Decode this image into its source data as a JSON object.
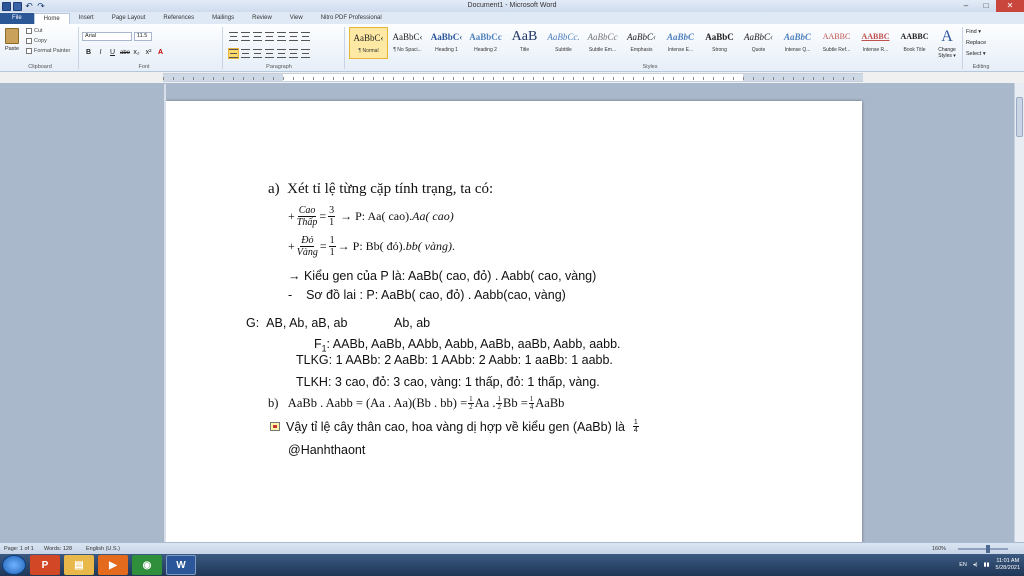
{
  "window": {
    "title": "Document1 - Microsoft Word",
    "controls": [
      "–",
      "□",
      "✕"
    ]
  },
  "tabs": [
    "File",
    "Home",
    "Insert",
    "Page Layout",
    "References",
    "Mailings",
    "Review",
    "View",
    "Nitro PDF Professional"
  ],
  "ribbon": {
    "clipboard": {
      "paste": "Paste",
      "cut": "Cut",
      "copy": "Copy",
      "format_painter": "Format Painter",
      "label": "Clipboard"
    },
    "font": {
      "name": "Arial",
      "size": "11.5",
      "label": "Font",
      "buttons": [
        "B",
        "I",
        "U",
        "abe",
        "x₂",
        "x²"
      ]
    },
    "paragraph": {
      "label": "Paragraph"
    },
    "styles": {
      "label": "Styles",
      "items": [
        {
          "sample": "AaBbC‹",
          "name": "¶ Normal"
        },
        {
          "sample": "AaBbC‹",
          "name": "¶ No Spaci..."
        },
        {
          "sample": "AaBbC‹",
          "name": "Heading 1"
        },
        {
          "sample": "AaBbCc",
          "name": "Heading 2"
        },
        {
          "sample": "AaB",
          "name": "Title"
        },
        {
          "sample": "AaBbCc.",
          "name": "Subtitle"
        },
        {
          "sample": "AaBbCc",
          "name": "Subtle Em..."
        },
        {
          "sample": "AaBbC‹",
          "name": "Emphasis"
        },
        {
          "sample": "AaBbC",
          "name": "Intense E..."
        },
        {
          "sample": "AaBbC",
          "name": "Strong"
        },
        {
          "sample": "AaBbC‹",
          "name": "Quote"
        },
        {
          "sample": "AaBbC",
          "name": "Intense Q..."
        },
        {
          "sample": "AABBC",
          "name": "Subtle Ref..."
        },
        {
          "sample": "AABBC",
          "name": "Intense R..."
        },
        {
          "sample": "AABBC",
          "name": "Book Title"
        }
      ]
    },
    "change_styles": {
      "glyph": "A",
      "label": "Change Styles ▾"
    },
    "editing": {
      "find": "Find ▾",
      "replace": "Replace",
      "select": "Select ▾",
      "label": "Editing"
    }
  },
  "document": {
    "line_a_label": "a)",
    "line_a_text": "Xét tỉ lệ từng cặp tính trạng, ta có:",
    "row1": {
      "plus": "+",
      "num": "Cao",
      "den": "Thấp",
      "eq": "=",
      "fnum": "3",
      "fden": "1",
      "arrow": "→",
      "text": "P: Aa( cao). ",
      "italic": "Aa( cao)"
    },
    "row2": {
      "plus": "+",
      "num": "Đỏ",
      "den": "Vàng",
      "eq": "=",
      "fnum": "1",
      "fden": "1",
      "arrow": "→",
      "text": "P: Bb( đỏ). ",
      "italic": "bb( vàng)",
      "end": "."
    },
    "kieu_gen": "→ Kiểu gen của P là: AaBb( cao, đỏ) . Aabb( cao, vàng)",
    "so_do_dash": "-",
    "so_do": "Sơ đồ lai : P: AaBb( cao, đỏ) . Aabb(cao, vàng)",
    "gametes_label": "G:",
    "gametes_1": "AB, Ab, aB, ab",
    "gametes_2": "Ab, ab",
    "f1_prefix": "F",
    "f1_sub": "1",
    "f1_text": ": AABb, AaBb, AAbb, Aabb, AaBb, aaBb, Aabb, aabb.",
    "tlkg": "TLKG: 1 AABb: 2 AaBb: 1 AAbb: 2 Aabb: 1 aaBb: 1 aabb.",
    "tlkh": "TLKH: 3 cao, đỏ: 3 cao, vàng: 1 thấp, đỏ: 1 thấp, vàng.",
    "line_b_label": "b)",
    "line_b_pre": "AaBb . Aabb = (Aa . Aa)(Bb . bb) = ",
    "line_b_f1": {
      "num": "1",
      "den": "2"
    },
    "line_b_mid1": " Aa . ",
    "line_b_f2": {
      "num": "1",
      "den": "2"
    },
    "line_b_mid2": " Bb = ",
    "line_b_f3": {
      "num": "1",
      "den": "4"
    },
    "line_b_end": " AaBb",
    "conclusion": "Vậy tỉ lệ cây thân cao, hoa vàng dị hợp về kiểu gen (AaBb) là",
    "conclusion_frac": {
      "num": "1",
      "den": "4"
    },
    "signature": "@Hanhthaont"
  },
  "statusbar": {
    "page": "Page: 1 of 1",
    "words": "Words: 128",
    "language": "English (U.S.)",
    "zoom": "160%"
  },
  "taskbar": {
    "apps": [
      "PowerPoint",
      "Explorer",
      "Media Player",
      "Chrome",
      "Word"
    ],
    "tray": {
      "lang": "EN",
      "time": "11:01 AM",
      "date": "5/28/2021"
    }
  }
}
